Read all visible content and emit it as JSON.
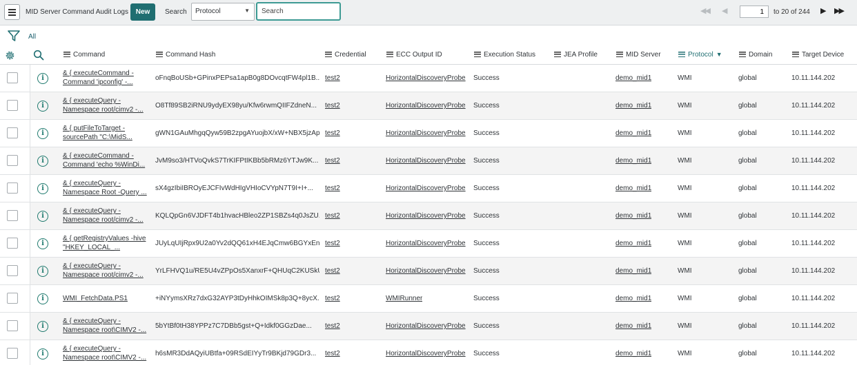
{
  "toolbar": {
    "title": "MID Server Command Audit Logs",
    "new_label": "New",
    "search_label": "Search",
    "search_field": "Protocol",
    "search_placeholder": "Search",
    "page_value": "1",
    "page_of": "to 20 of 244"
  },
  "filter": {
    "label": "All"
  },
  "columns": {
    "command": "Command",
    "command_hash": "Command Hash",
    "credential": "Credential",
    "ecc_output_id": "ECC Output ID",
    "execution_status": "Execution Status",
    "jea_profile": "JEA Profile",
    "mid_server": "MID Server",
    "protocol": "Protocol",
    "domain": "Domain",
    "target_device": "Target Device"
  },
  "rows": [
    {
      "cmd1": "& { executeCommand -",
      "cmd2": "Command 'ipconfig' -...",
      "hash": "oFnqBoUSb+GPinxPEPsa1apB0g8DOvcqtFW4pl1B...",
      "credential": "test2",
      "ecc": "HorizontalDiscoveryProbe",
      "status": "Success",
      "jea": "",
      "mid": "demo_mid1",
      "protocol": "WMI",
      "domain": "global",
      "target": "10.11.144.202"
    },
    {
      "cmd1": "& { executeQuery -",
      "cmd2": "Namespace root/cimv2 -...",
      "hash": "O8Tf89SB2iRNU9ydyEX98yu/Kfw6rwmQIIFZdneN...",
      "credential": "test2",
      "ecc": "HorizontalDiscoveryProbe",
      "status": "Success",
      "jea": "",
      "mid": "demo_mid1",
      "protocol": "WMI",
      "domain": "global",
      "target": "10.11.144.202"
    },
    {
      "cmd1": "& { putFileToTarget -",
      "cmd2": "sourcePath \"C:\\MidS...",
      "hash": "gWN1GAuMhgqQyw59B2zpgAYuojbX/xW+NBX5jzAp...",
      "credential": "test2",
      "ecc": "HorizontalDiscoveryProbe",
      "status": "Success",
      "jea": "",
      "mid": "demo_mid1",
      "protocol": "WMI",
      "domain": "global",
      "target": "10.11.144.202"
    },
    {
      "cmd1": "& { executeCommand -",
      "cmd2": "Command 'echo %WinDi...",
      "hash": "JvM9so3/HTVoQvkS7TrKIFPtIKBb5bRMz6YTJw9K...",
      "credential": "test2",
      "ecc": "HorizontalDiscoveryProbe",
      "status": "Success",
      "jea": "",
      "mid": "demo_mid1",
      "protocol": "WMI",
      "domain": "global",
      "target": "10.11.144.202"
    },
    {
      "cmd1": "& { executeQuery -",
      "cmd2": "Namespace Root -Query ...",
      "hash": "sX4gzIbiIBROyEJCFIvWdHIgVHIoCVYpN7T9I+I+...",
      "credential": "test2",
      "ecc": "HorizontalDiscoveryProbe",
      "status": "Success",
      "jea": "",
      "mid": "demo_mid1",
      "protocol": "WMI",
      "domain": "global",
      "target": "10.11.144.202"
    },
    {
      "cmd1": "& { executeQuery -",
      "cmd2": "Namespace root/cimv2 -...",
      "hash": "KQLQpGn6VJDFT4b1hvacHBleo2ZP1SBZs4q0JsZU...",
      "credential": "test2",
      "ecc": "HorizontalDiscoveryProbe",
      "status": "Success",
      "jea": "",
      "mid": "demo_mid1",
      "protocol": "WMI",
      "domain": "global",
      "target": "10.11.144.202"
    },
    {
      "cmd1": "& { getRegistryValues -hive",
      "cmd2": "\"HKEY_LOCAL_...",
      "hash": "JUyLqUIjRpx9U2a0Yv2dQQ61xH4EJqCmw6BGYxEn...",
      "credential": "test2",
      "ecc": "HorizontalDiscoveryProbe",
      "status": "Success",
      "jea": "",
      "mid": "demo_mid1",
      "protocol": "WMI",
      "domain": "global",
      "target": "10.11.144.202"
    },
    {
      "cmd1": "& { executeQuery -",
      "cmd2": "Namespace root/cimv2 -...",
      "hash": "YrLFHVQ1u/RE5U4vZPpOs5XanxrF+QHUqC2KUSkU...",
      "credential": "test2",
      "ecc": "HorizontalDiscoveryProbe",
      "status": "Success",
      "jea": "",
      "mid": "demo_mid1",
      "protocol": "WMI",
      "domain": "global",
      "target": "10.11.144.202"
    },
    {
      "cmd1": "WMI_FetchData.PS1",
      "cmd2": "",
      "hash": "+iNYymsXRz7dxG32AYP3tDyHhkOIMSk8p3Q+8ycX...",
      "credential": "test2",
      "ecc": "WMIRunner",
      "status": "Success",
      "jea": "",
      "mid": "demo_mid1",
      "protocol": "WMI",
      "domain": "global",
      "target": "10.11.144.202"
    },
    {
      "cmd1": "& { executeQuery -",
      "cmd2": "Namespace root\\CIMV2 -...",
      "hash": "5bYtBf0tH38YPPz7C7DBb5gst+Q+Idkf0GGzDae...",
      "credential": "test2",
      "ecc": "HorizontalDiscoveryProbe",
      "status": "Success",
      "jea": "",
      "mid": "demo_mid1",
      "protocol": "WMI",
      "domain": "global",
      "target": "10.11.144.202"
    },
    {
      "cmd1": "& { executeQuery -",
      "cmd2": "Namespace root\\CIMV2 -...",
      "hash": "h6sMR3DdAQyiUBtfa+09RSdEIYyTr9BKjd79GDr3...",
      "credential": "test2",
      "ecc": "HorizontalDiscoveryProbe",
      "status": "Success",
      "jea": "",
      "mid": "demo_mid1",
      "protocol": "WMI",
      "domain": "global",
      "target": "10.11.144.202"
    }
  ],
  "icons": {
    "menu": "menu-icon",
    "filter": "funnel-icon",
    "settings": "gear-icon",
    "search": "search-icon",
    "info": "info-icon",
    "first": "first-page-icon",
    "prev": "prev-page-icon",
    "next": "next-page-icon",
    "last": "last-page-icon"
  },
  "colors": {
    "accent": "#1f6e71",
    "toolbar_bg": "#eef0f1",
    "row_alt": "#f4f4f4"
  }
}
